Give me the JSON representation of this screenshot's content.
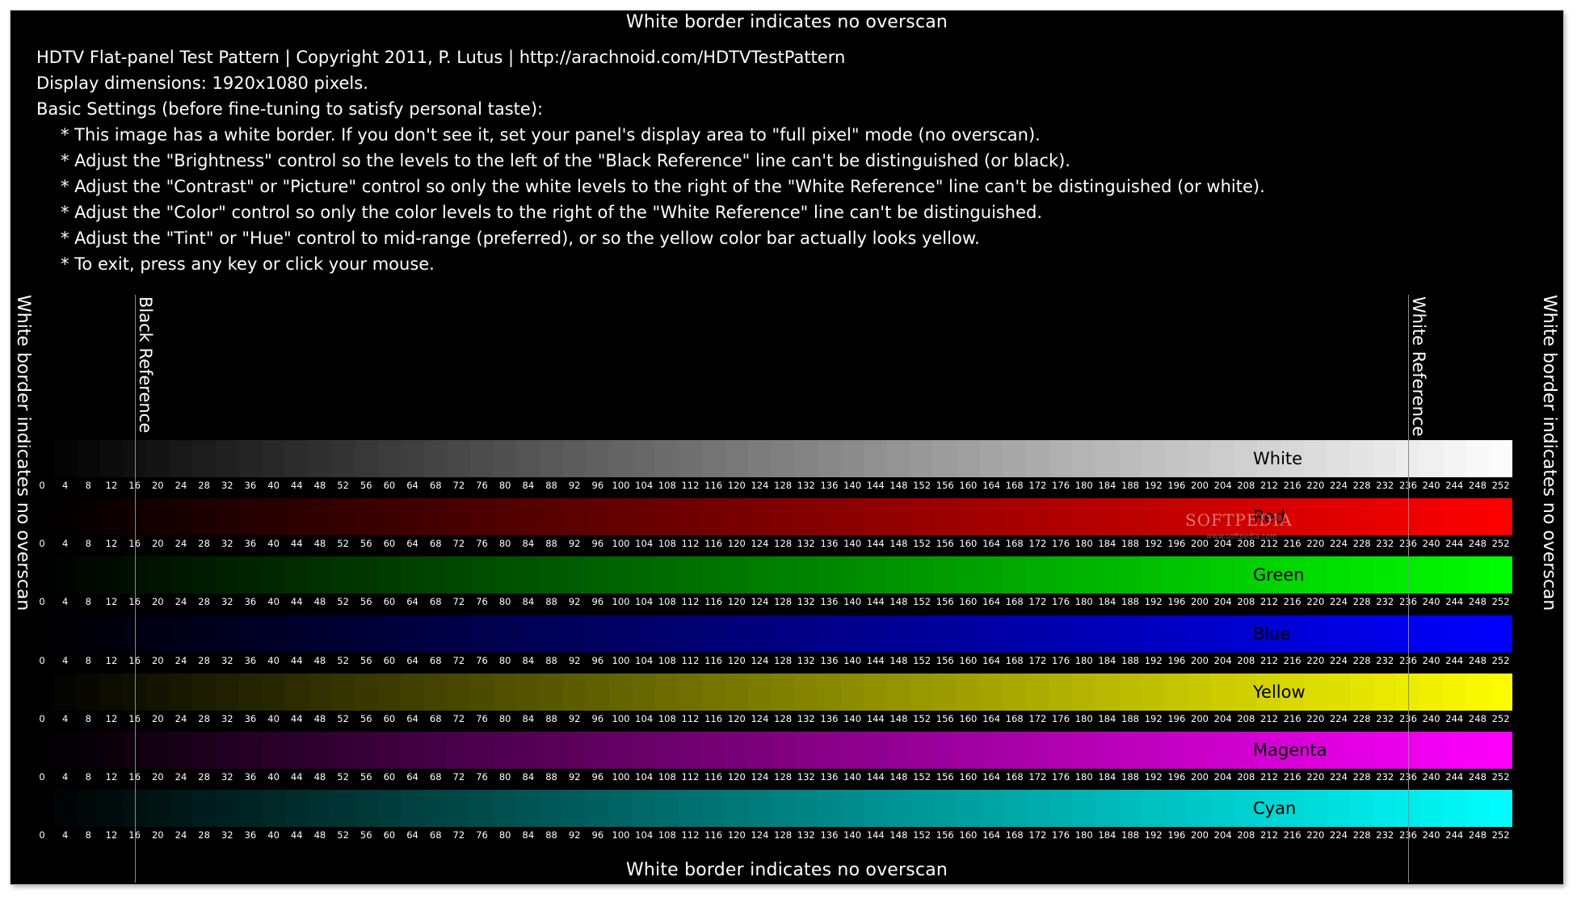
{
  "border_caption": "White border indicates no overscan",
  "header": {
    "title_line": "HDTV Flat-panel Test Pattern | Copyright 2011, P. Lutus | http://arachnoid.com/HDTVTestPattern",
    "dimensions_line": "Display dimensions: 1920x1080 pixels.",
    "settings_heading": "Basic Settings (before fine-tuning to satisfy personal taste):",
    "instructions": [
      "* This image has a white border. If you don't see it, set your panel's display area to \"full pixel\" mode (no overscan).",
      "* Adjust the \"Brightness\" control so the levels to the left of the \"Black Reference\" line can't be distinguished (or black).",
      "* Adjust the \"Contrast\" or \"Picture\" control so only the white levels to the right of the \"White Reference\" line can't be distinguished (or white).",
      "* Adjust the \"Color\" control so only the color levels to the right of the \"White Reference\" line can't be distinguished.",
      "* Adjust the \"Tint\" or \"Hue\" control to mid-range (preferred), or so the yellow color bar actually looks yellow.",
      "* To exit, press any key or click your mouse."
    ]
  },
  "references": {
    "black": {
      "label": "Black Reference",
      "level": 16
    },
    "white": {
      "label": "White Reference",
      "level": 236
    }
  },
  "levels": {
    "start": 0,
    "end": 252,
    "step": 4
  },
  "bands": [
    {
      "name": "White",
      "color": "#ffffff",
      "label_color": "#000000"
    },
    {
      "name": "Red",
      "color": "#ff0000",
      "label_color": "#000000"
    },
    {
      "name": "Green",
      "color": "#00ff00",
      "label_color": "#000000"
    },
    {
      "name": "Blue",
      "color": "#0000ff",
      "label_color": "#000000"
    },
    {
      "name": "Yellow",
      "color": "#ffff00",
      "label_color": "#000000"
    },
    {
      "name": "Magenta",
      "color": "#ff00ff",
      "label_color": "#000000"
    },
    {
      "name": "Cyan",
      "color": "#00ffff",
      "label_color": "#000000"
    }
  ],
  "watermark": {
    "text": "SOFTPEDIA",
    "sub": "www.softpedia.com"
  }
}
